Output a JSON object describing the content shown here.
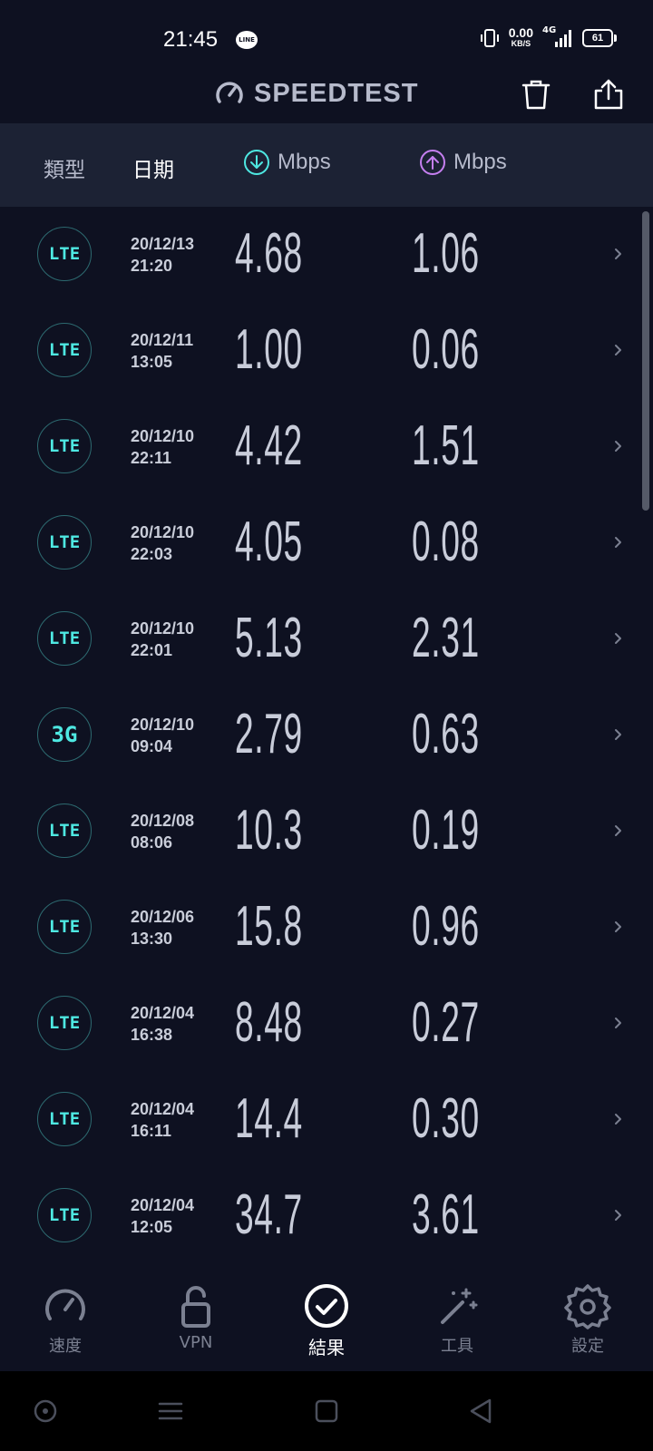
{
  "status_bar": {
    "time": "21:45",
    "line_badge": "LINE",
    "net_speed_value": "0.00",
    "net_speed_unit": "KB/S",
    "network_type": "4G",
    "battery": "61"
  },
  "header": {
    "title": "SPEEDTEST"
  },
  "columns": {
    "type": "類型",
    "date": "日期",
    "download_unit": "Mbps",
    "upload_unit": "Mbps"
  },
  "colors": {
    "background": "#0e1121",
    "header_bar": "#1c2234",
    "download_accent": "#4ee8e2",
    "upload_accent": "#c57ff0",
    "text_muted": "#b6bacb"
  },
  "results": [
    {
      "type": "LTE",
      "date": "20/12/13",
      "time": "21:20",
      "download": "4.68",
      "upload": "1.06"
    },
    {
      "type": "LTE",
      "date": "20/12/11",
      "time": "13:05",
      "download": "1.00",
      "upload": "0.06"
    },
    {
      "type": "LTE",
      "date": "20/12/10",
      "time": "22:11",
      "download": "4.42",
      "upload": "1.51"
    },
    {
      "type": "LTE",
      "date": "20/12/10",
      "time": "22:03",
      "download": "4.05",
      "upload": "0.08"
    },
    {
      "type": "LTE",
      "date": "20/12/10",
      "time": "22:01",
      "download": "5.13",
      "upload": "2.31"
    },
    {
      "type": "3G",
      "date": "20/12/10",
      "time": "09:04",
      "download": "2.79",
      "upload": "0.63"
    },
    {
      "type": "LTE",
      "date": "20/12/08",
      "time": "08:06",
      "download": "10.3",
      "upload": "0.19"
    },
    {
      "type": "LTE",
      "date": "20/12/06",
      "time": "13:30",
      "download": "15.8",
      "upload": "0.96"
    },
    {
      "type": "LTE",
      "date": "20/12/04",
      "time": "16:38",
      "download": "8.48",
      "upload": "0.27"
    },
    {
      "type": "LTE",
      "date": "20/12/04",
      "time": "16:11",
      "download": "14.4",
      "upload": "0.30"
    },
    {
      "type": "LTE",
      "date": "20/12/04",
      "time": "12:05",
      "download": "34.7",
      "upload": "3.61"
    }
  ],
  "nav": [
    {
      "label": "速度",
      "icon": "speedometer-icon"
    },
    {
      "label": "VPN",
      "icon": "padlock-icon"
    },
    {
      "label": "結果",
      "icon": "check-circle-icon",
      "active": true
    },
    {
      "label": "工具",
      "icon": "magic-wand-icon"
    },
    {
      "label": "設定",
      "icon": "gear-icon"
    }
  ]
}
